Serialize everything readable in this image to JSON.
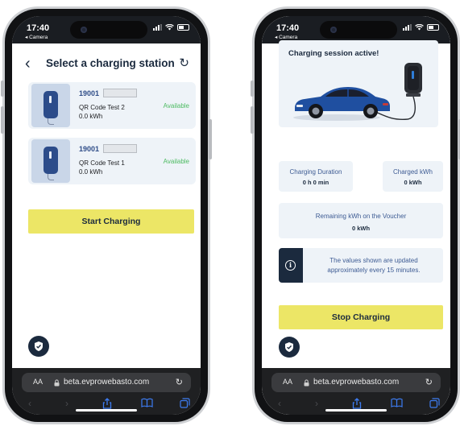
{
  "left_phone": {
    "status_time": "17:40",
    "back_app": "◂ Camera",
    "page_title": "Select a charging station",
    "stations": [
      {
        "id": "19001",
        "name": "QR Code Test 2",
        "energy": "0.0 kWh",
        "status": "Available"
      },
      {
        "id": "19001",
        "name": "QR Code Test 1",
        "energy": "0.0 kWh",
        "status": "Available"
      }
    ],
    "start_button": "Start Charging",
    "browser": {
      "aa": "AA",
      "url": "beta.evprowebasto.com"
    }
  },
  "right_phone": {
    "status_time": "17:40",
    "back_app": "◂ Camera",
    "session_title": "Charging session active!",
    "duration_label": "Charging Duration",
    "duration_value": "0 h 0 min",
    "charged_label": "Charged kWh",
    "charged_value": "0 kWh",
    "remaining_label": "Remaining kWh on the Voucher",
    "remaining_value": "0 kWh",
    "info_note": "The values shown are updated approximately every 15 minutes.",
    "stop_button": "Stop Charging",
    "browser": {
      "aa": "AA",
      "url": "beta.evprowebasto.com"
    }
  },
  "colors": {
    "brand_navy": "#1b2a3e",
    "accent_yellow": "#ece666",
    "available_green": "#4dbb62",
    "card_bg": "#eef3f8",
    "car_blue": "#1f4fa0"
  },
  "icons": [
    "chevron-left-icon",
    "refresh-icon",
    "shield-icon",
    "info-icon",
    "lock-icon",
    "share-icon",
    "bookmarks-icon",
    "tabs-icon"
  ]
}
